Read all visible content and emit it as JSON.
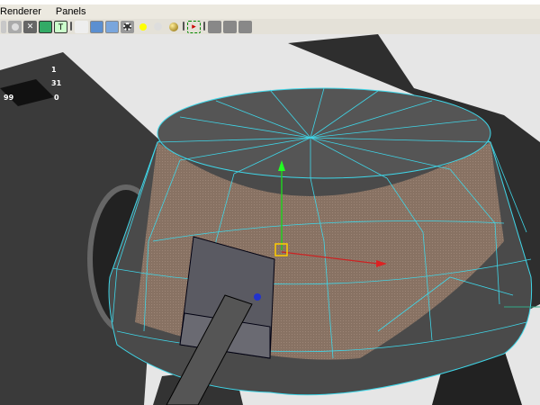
{
  "menu": {
    "items": [
      "Renderer",
      "Panels"
    ]
  },
  "toolbar": {
    "icons": [
      "grid-icon",
      "camera-icon",
      "wireframe-icon",
      "xray-icon",
      "texture-icon",
      "shaded-box-icon",
      "smooth-shaded-icon",
      "bounding-box-icon",
      "light-icon",
      "default-light-icon",
      "all-lights-icon",
      "isolate-select-icon",
      "xray-mode-icon",
      "xray-joints-icon",
      "component-icon"
    ],
    "text_icon_label": "T"
  },
  "hud": {
    "values": [
      "1",
      "31",
      "99",
      "0"
    ]
  },
  "colors": {
    "wireframe": "#3fd6e8",
    "mesh": "#8a7565",
    "menubar": "#ece9e0"
  }
}
